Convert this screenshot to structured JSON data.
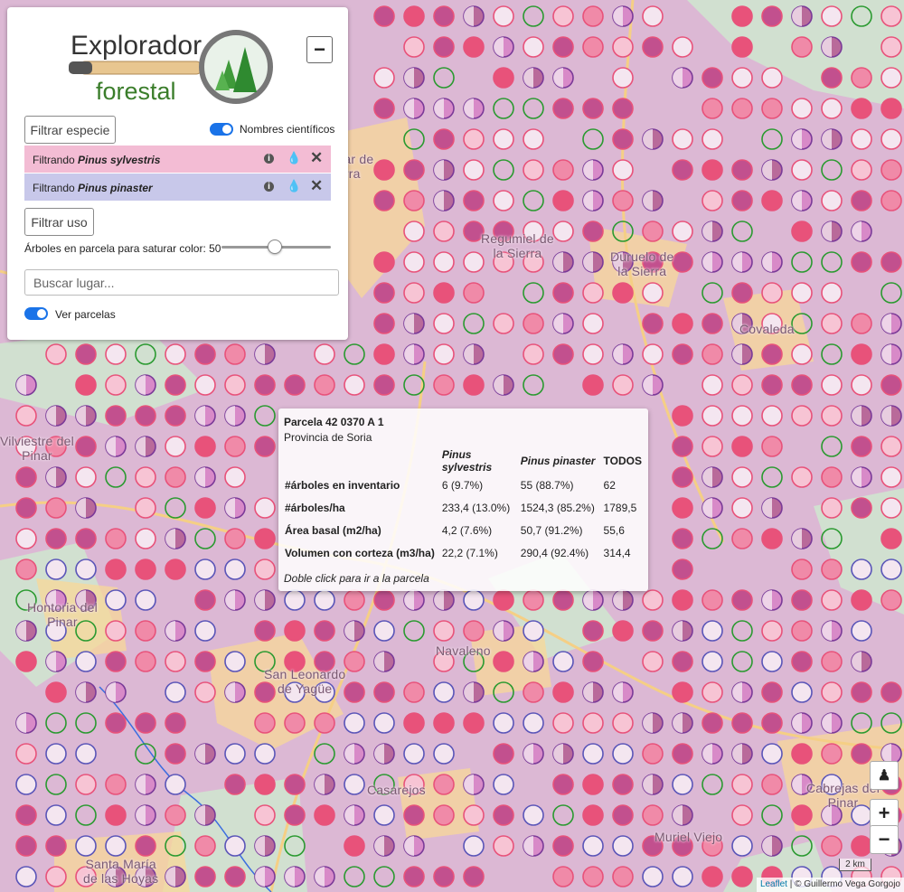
{
  "app": {
    "logo_line1": "Explorador",
    "logo_line2": "forestal"
  },
  "panel": {
    "collapse_label": "−",
    "filter_species_label": "Filtrar especie",
    "scientific_names_label": "Nombres científicos",
    "scientific_names_on": true,
    "filters": [
      {
        "prefix": "Filtrando ",
        "species": "Pinus sylvestris",
        "color": "#f3bcd4"
      },
      {
        "prefix": "Filtrando ",
        "species": "Pinus pinaster",
        "color": "#c8c8ea"
      }
    ],
    "filter_use_label": "Filtrar uso",
    "saturation_label": "Árboles en parcela para saturar color: 50",
    "saturation_value": 50,
    "search_placeholder": "Buscar lugar...",
    "show_plots_label": "Ver parcelas",
    "show_plots_on": true
  },
  "map": {
    "places": [
      "Quintanar de\nla Sierra",
      "Regumiel de\nla Sierra",
      "Duruelo de\nla Sierra",
      "Covaleda",
      "Hontoria del\nPinar",
      "Navaleno",
      "San Leonardo\nde Yagüe",
      "Casarejos",
      "Muriel Viejo",
      "Santa María\nde las Hoyas",
      "Cabrejas del\nPinar",
      "Vilviestre del\nPinar"
    ],
    "colors": {
      "background": "#dcb8d4",
      "sylvestris": "#e8527a",
      "pinaster": "#5a55b8",
      "empty_plot": "#2a9a30",
      "roads": "#f8d898",
      "forest_open": "#cfe6cf"
    }
  },
  "popup": {
    "title": "Parcela 42 0370 A 1",
    "subtitle": "Provincia de Soria",
    "headers": [
      "",
      "Pinus sylvestris",
      "Pinus pinaster",
      "TODOS"
    ],
    "rows": [
      [
        "#árboles en inventario",
        "6 (9.7%)",
        "55 (88.7%)",
        "62"
      ],
      [
        "#árboles/ha",
        "233,4 (13.0%)",
        "1524,3 (85.2%)",
        "1789,5"
      ],
      [
        "Área basal (m2/ha)",
        "4,2 (7.6%)",
        "50,7 (91.2%)",
        "55,6"
      ],
      [
        "Volumen con corteza (m3/ha)",
        "22,2 (7.1%)",
        "290,4 (92.4%)",
        "314,4"
      ]
    ],
    "footer": "Doble click para ir a la parcela"
  },
  "controls": {
    "zoom_in": "+",
    "zoom_out": "−",
    "scale_label": "2 km",
    "attribution_link": "Leaflet",
    "attribution_text": " | © Guillermo Vega Gorgojo"
  }
}
